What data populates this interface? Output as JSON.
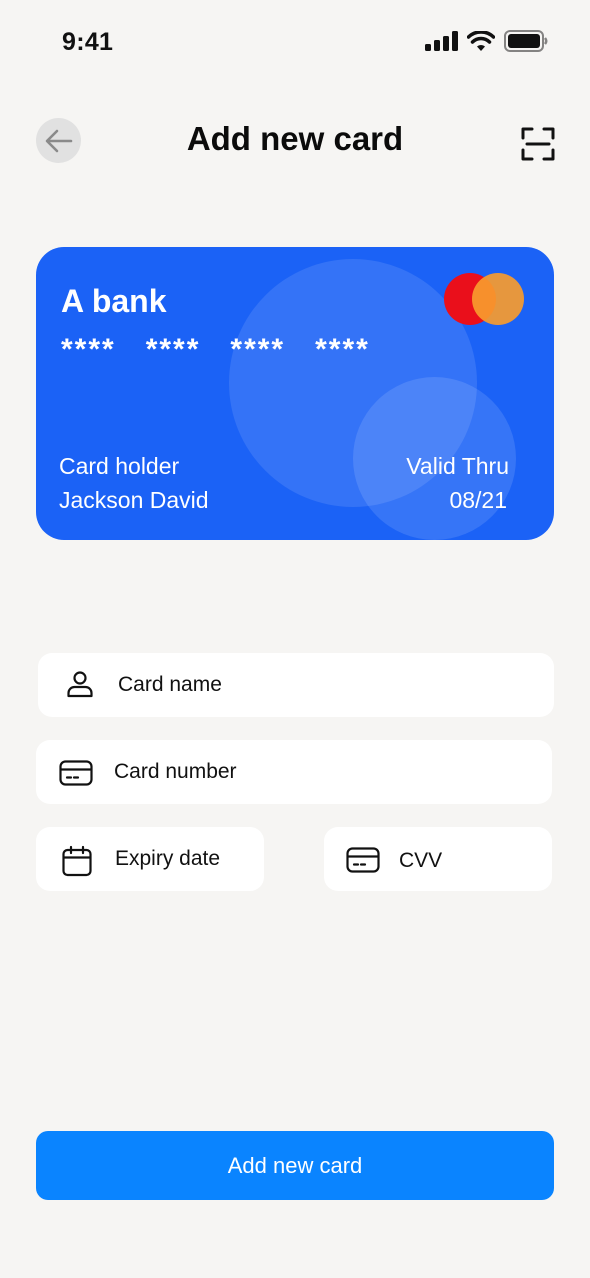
{
  "status_bar": {
    "time": "9:41"
  },
  "header": {
    "title": "Add new card"
  },
  "card": {
    "bank_name": "A bank",
    "number_groups": [
      "****",
      "****",
      "****",
      "****"
    ],
    "holder_label": "Card holder",
    "holder_name": "Jackson David",
    "valid_label": "Valid Thru",
    "valid_date": "08/21",
    "color": "#1b62f6"
  },
  "form": {
    "card_name": {
      "placeholder": "Card name",
      "value": ""
    },
    "card_number": {
      "placeholder": "Card number",
      "value": ""
    },
    "expiry_date": {
      "placeholder": "Expiry date",
      "value": ""
    },
    "cvv": {
      "placeholder": "CVV",
      "value": ""
    }
  },
  "primary_button": {
    "label": "Add new card",
    "color": "#0a84ff"
  }
}
